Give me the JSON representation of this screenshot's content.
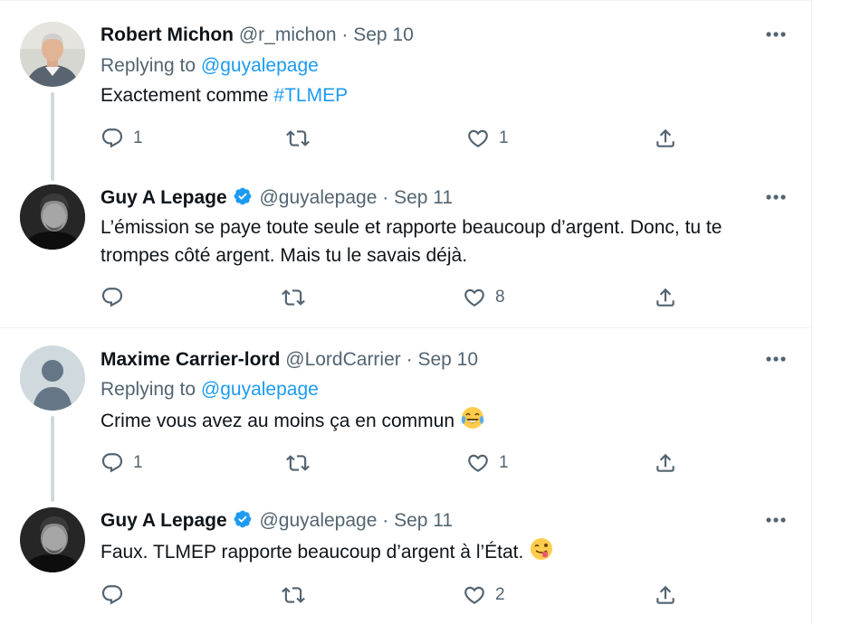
{
  "tweets": [
    {
      "name": "Robert Michon",
      "handle": "@r_michon",
      "dot": "·",
      "date": "Sep 10",
      "verified": false,
      "replying_prefix": "Replying to ",
      "replying_to": "@guyalepage",
      "text_plain": "Exactement comme ",
      "text_hashtag": "#TLMEP",
      "reply_count": "1",
      "retweet_count": "",
      "like_count": "1"
    },
    {
      "name": "Guy A Lepage",
      "handle": "@guyalepage",
      "dot": "·",
      "date": "Sep 11",
      "verified": true,
      "text": "L’émission se paye toute seule et rapporte beaucoup d’argent. Donc, tu te trompes côté argent. Mais tu le savais déjà.",
      "reply_count": "",
      "retweet_count": "",
      "like_count": "8"
    },
    {
      "name": "Maxime Carrier-lord",
      "handle": "@LordCarrier",
      "dot": "·",
      "date": "Sep 10",
      "verified": false,
      "replying_prefix": "Replying to ",
      "replying_to": "@guyalepage",
      "text": "Crime vous avez au moins ça en commun",
      "emoji": "face-with-tears-of-joy",
      "reply_count": "1",
      "retweet_count": "",
      "like_count": "1"
    },
    {
      "name": "Guy A Lepage",
      "handle": "@guyalepage",
      "dot": "·",
      "date": "Sep 11",
      "verified": true,
      "text": "Faux. TLMEP rapporte beaucoup d’argent à l’État.",
      "emoji": "winking-face-with-tongue",
      "reply_count": "",
      "retweet_count": "",
      "like_count": "2"
    }
  ],
  "colors": {
    "link": "#1d9bf0",
    "secondary_text": "#536471",
    "thread_line": "#cfd9de",
    "divider": "#eff3f4"
  },
  "icons": [
    "reply-icon",
    "retweet-icon",
    "like-icon",
    "share-icon",
    "more-options-icon",
    "verified-badge-icon"
  ]
}
